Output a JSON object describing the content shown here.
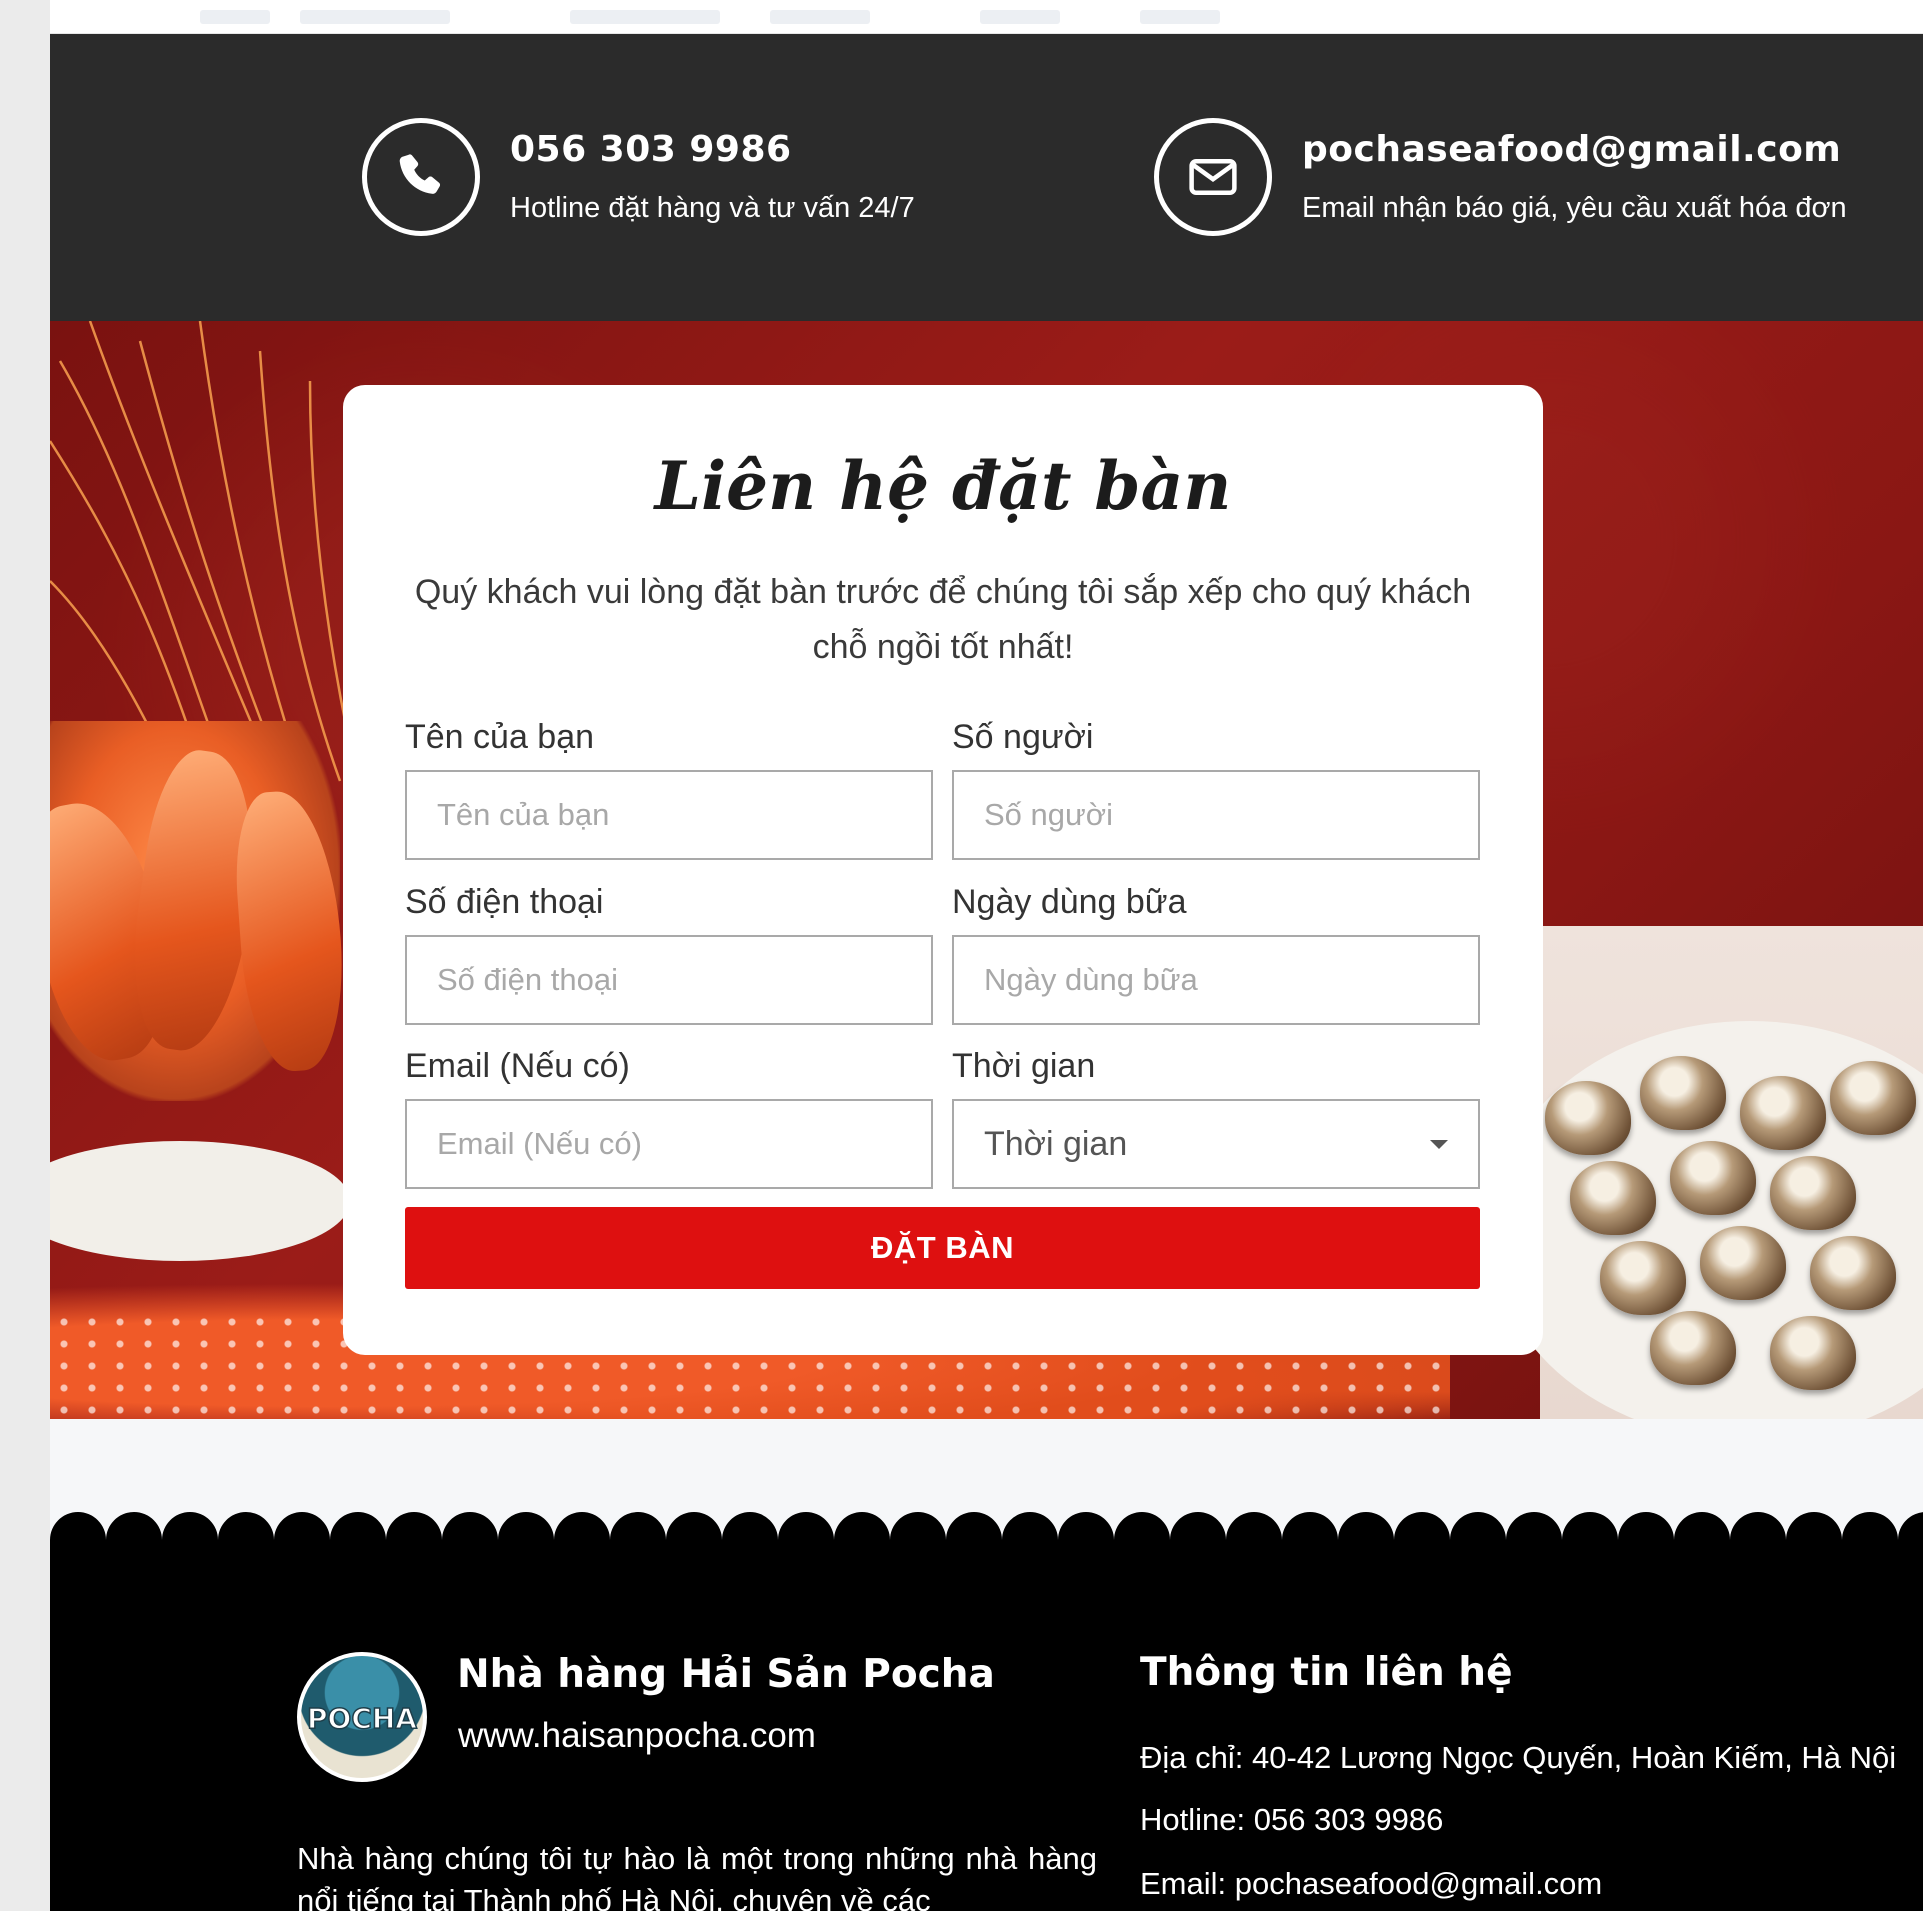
{
  "contact_bar": {
    "phone": {
      "icon": "phone-icon",
      "title": "056 303 9986",
      "subtitle": "Hotline đặt hàng và tư vấn 24/7"
    },
    "email": {
      "icon": "mail-icon",
      "title": "pochaseafood@gmail.com",
      "subtitle": "Email nhận báo giá, yêu cầu xuất hóa đơn"
    }
  },
  "booking_form": {
    "title": "Liên hệ đặt bàn",
    "description": "Quý khách vui lòng đặt bàn trước để chúng tôi sắp xếp cho quý khách chỗ ngồi tốt nhất!",
    "fields": {
      "name": {
        "label": "Tên của bạn",
        "placeholder": "Tên của bạn"
      },
      "guests": {
        "label": "Số người",
        "placeholder": "Số người"
      },
      "phone": {
        "label": "Số điện thoại",
        "placeholder": "Số điện thoại"
      },
      "date": {
        "label": "Ngày dùng bữa",
        "placeholder": "Ngày dùng bữa"
      },
      "email": {
        "label": "Email (Nếu có)",
        "placeholder": "Email (Nếu có)"
      },
      "time": {
        "label": "Thời gian",
        "selected": "Thời gian"
      }
    },
    "submit_label": "ĐẶT BÀN",
    "accent_color": "#de1010"
  },
  "footer": {
    "logo_text": "POCHA",
    "brand_name": "Nhà hàng Hải Sản Pocha",
    "website": "www.haisanpocha.com",
    "about": "Nhà hàng chúng tôi tự hào là một trong những nhà hàng nổi tiếng tại Thành phố Hà Nội, chuyên về các",
    "contact": {
      "title": "Thông tin liên hệ",
      "address": "Địa chỉ: 40-42 Lương Ngọc Quyến, Hoàn Kiếm, Hà Nội",
      "hotline": "Hotline: 056 303 9986",
      "email": "Email: pochaseafood@gmail.com"
    }
  }
}
